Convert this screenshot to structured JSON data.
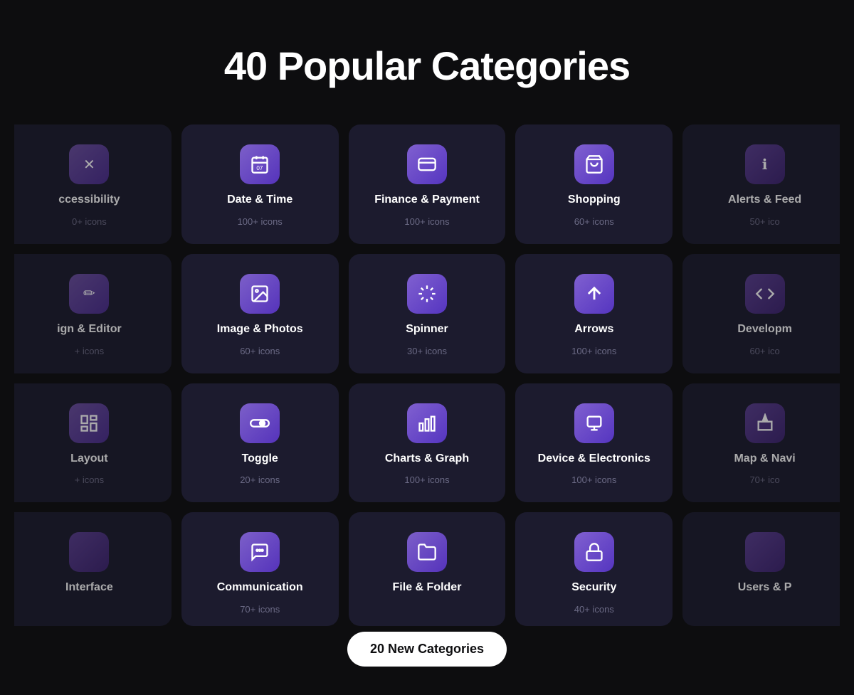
{
  "page": {
    "title": "40 Popular Categories"
  },
  "badge": {
    "label": "20 New Categories"
  },
  "grid": {
    "rows": [
      [
        {
          "id": "accessibility",
          "title": "ccessibility",
          "subtitle": "0+ icons",
          "icon": "✕",
          "partial": "left"
        },
        {
          "id": "date-time",
          "title": "Date & Time",
          "subtitle": "100+ icons",
          "icon": "📅",
          "partial": ""
        },
        {
          "id": "finance-payment",
          "title": "Finance & Payment",
          "subtitle": "100+ icons",
          "icon": "💳",
          "partial": ""
        },
        {
          "id": "shopping",
          "title": "Shopping",
          "subtitle": "60+ icons",
          "icon": "🛒",
          "partial": ""
        },
        {
          "id": "alerts-feed",
          "title": "Alerts & Feed",
          "subtitle": "50+ ico",
          "icon": "ℹ",
          "partial": "right"
        }
      ],
      [
        {
          "id": "design-editor",
          "title": "ign & Editor",
          "subtitle": "+ icons",
          "icon": "✏",
          "partial": "left"
        },
        {
          "id": "image-photos",
          "title": "Image & Photos",
          "subtitle": "60+ icons",
          "icon": "🖼",
          "partial": ""
        },
        {
          "id": "spinner",
          "title": "Spinner",
          "subtitle": "30+ icons",
          "icon": "✳",
          "partial": ""
        },
        {
          "id": "arrows",
          "title": "Arrows",
          "subtitle": "100+ icons",
          "icon": "↑",
          "partial": ""
        },
        {
          "id": "development",
          "title": "Developm",
          "subtitle": "60+ ico",
          "icon": "</>",
          "partial": "right"
        }
      ],
      [
        {
          "id": "layout",
          "title": "Layout",
          "subtitle": "+ icons",
          "icon": "⊞",
          "partial": "left"
        },
        {
          "id": "toggle",
          "title": "Toggle",
          "subtitle": "20+ icons",
          "icon": "◉",
          "partial": ""
        },
        {
          "id": "charts-graph",
          "title": "Charts & Graph",
          "subtitle": "100+ icons",
          "icon": "📊",
          "partial": ""
        },
        {
          "id": "device-electronics",
          "title": "Device & Electronics",
          "subtitle": "100+ icons",
          "icon": "🖥",
          "partial": ""
        },
        {
          "id": "map-navi",
          "title": "Map & Navi",
          "subtitle": "70+ ico",
          "icon": "⟨",
          "partial": "right"
        }
      ],
      [
        {
          "id": "interface",
          "title": "Interface",
          "subtitle": "",
          "icon": "◻",
          "partial": "left"
        },
        {
          "id": "communication",
          "title": "Communication",
          "subtitle": "70+ icons",
          "icon": "💬",
          "partial": ""
        },
        {
          "id": "file-folder",
          "title": "File & Folder",
          "subtitle": "",
          "icon": "📁",
          "partial": ""
        },
        {
          "id": "security",
          "title": "Security",
          "subtitle": "40+ icons",
          "icon": "🔒",
          "partial": ""
        },
        {
          "id": "users",
          "title": "Users & P",
          "subtitle": "",
          "icon": "👤",
          "partial": "right"
        }
      ]
    ]
  }
}
